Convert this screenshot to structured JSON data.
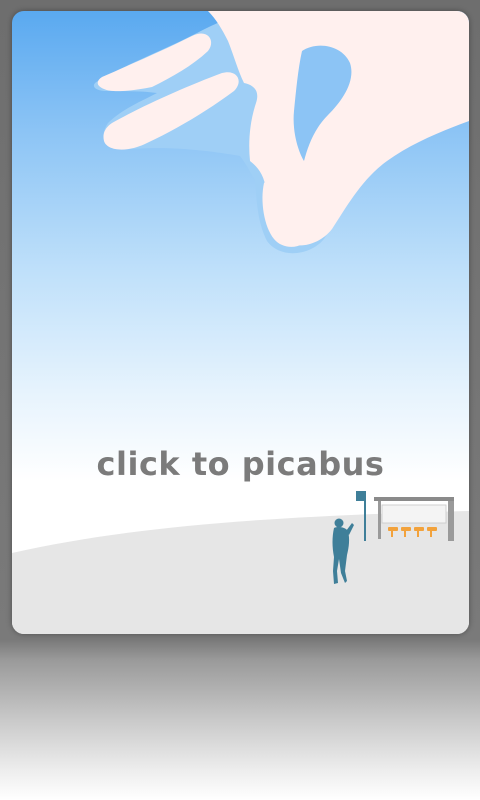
{
  "app": {
    "title": "click to picabus"
  },
  "scene": {
    "hand_icon": "pinching-hand",
    "person_icon": "waiting-person",
    "bus_stop_icon": "bus-stop-shelter",
    "colors": {
      "sky_top": "#5aa9f0",
      "sky_bottom": "#ffffff",
      "hand_fill": "#fff0ee",
      "hand_outline": "#8cc4f5",
      "ground": "#e6e6e6",
      "figure": "#3f7f99",
      "seats": "#f2a23c",
      "title_text": "#7b7b7b"
    }
  }
}
